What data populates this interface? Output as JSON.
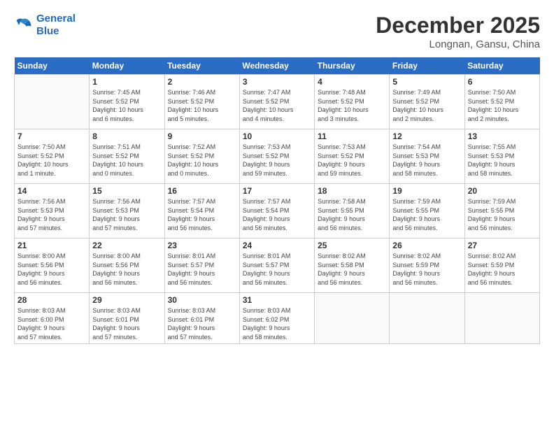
{
  "header": {
    "logo_line1": "General",
    "logo_line2": "Blue",
    "month": "December 2025",
    "location": "Longnan, Gansu, China"
  },
  "weekdays": [
    "Sunday",
    "Monday",
    "Tuesday",
    "Wednesday",
    "Thursday",
    "Friday",
    "Saturday"
  ],
  "weeks": [
    [
      {
        "day": "",
        "info": ""
      },
      {
        "day": "1",
        "info": "Sunrise: 7:45 AM\nSunset: 5:52 PM\nDaylight: 10 hours\nand 6 minutes."
      },
      {
        "day": "2",
        "info": "Sunrise: 7:46 AM\nSunset: 5:52 PM\nDaylight: 10 hours\nand 5 minutes."
      },
      {
        "day": "3",
        "info": "Sunrise: 7:47 AM\nSunset: 5:52 PM\nDaylight: 10 hours\nand 4 minutes."
      },
      {
        "day": "4",
        "info": "Sunrise: 7:48 AM\nSunset: 5:52 PM\nDaylight: 10 hours\nand 3 minutes."
      },
      {
        "day": "5",
        "info": "Sunrise: 7:49 AM\nSunset: 5:52 PM\nDaylight: 10 hours\nand 2 minutes."
      },
      {
        "day": "6",
        "info": "Sunrise: 7:50 AM\nSunset: 5:52 PM\nDaylight: 10 hours\nand 2 minutes."
      }
    ],
    [
      {
        "day": "7",
        "info": "Sunrise: 7:50 AM\nSunset: 5:52 PM\nDaylight: 10 hours\nand 1 minute."
      },
      {
        "day": "8",
        "info": "Sunrise: 7:51 AM\nSunset: 5:52 PM\nDaylight: 10 hours\nand 0 minutes."
      },
      {
        "day": "9",
        "info": "Sunrise: 7:52 AM\nSunset: 5:52 PM\nDaylight: 10 hours\nand 0 minutes."
      },
      {
        "day": "10",
        "info": "Sunrise: 7:53 AM\nSunset: 5:52 PM\nDaylight: 9 hours\nand 59 minutes."
      },
      {
        "day": "11",
        "info": "Sunrise: 7:53 AM\nSunset: 5:52 PM\nDaylight: 9 hours\nand 59 minutes."
      },
      {
        "day": "12",
        "info": "Sunrise: 7:54 AM\nSunset: 5:53 PM\nDaylight: 9 hours\nand 58 minutes."
      },
      {
        "day": "13",
        "info": "Sunrise: 7:55 AM\nSunset: 5:53 PM\nDaylight: 9 hours\nand 58 minutes."
      }
    ],
    [
      {
        "day": "14",
        "info": "Sunrise: 7:56 AM\nSunset: 5:53 PM\nDaylight: 9 hours\nand 57 minutes."
      },
      {
        "day": "15",
        "info": "Sunrise: 7:56 AM\nSunset: 5:53 PM\nDaylight: 9 hours\nand 57 minutes."
      },
      {
        "day": "16",
        "info": "Sunrise: 7:57 AM\nSunset: 5:54 PM\nDaylight: 9 hours\nand 56 minutes."
      },
      {
        "day": "17",
        "info": "Sunrise: 7:57 AM\nSunset: 5:54 PM\nDaylight: 9 hours\nand 56 minutes."
      },
      {
        "day": "18",
        "info": "Sunrise: 7:58 AM\nSunset: 5:55 PM\nDaylight: 9 hours\nand 56 minutes."
      },
      {
        "day": "19",
        "info": "Sunrise: 7:59 AM\nSunset: 5:55 PM\nDaylight: 9 hours\nand 56 minutes."
      },
      {
        "day": "20",
        "info": "Sunrise: 7:59 AM\nSunset: 5:55 PM\nDaylight: 9 hours\nand 56 minutes."
      }
    ],
    [
      {
        "day": "21",
        "info": "Sunrise: 8:00 AM\nSunset: 5:56 PM\nDaylight: 9 hours\nand 56 minutes."
      },
      {
        "day": "22",
        "info": "Sunrise: 8:00 AM\nSunset: 5:56 PM\nDaylight: 9 hours\nand 56 minutes."
      },
      {
        "day": "23",
        "info": "Sunrise: 8:01 AM\nSunset: 5:57 PM\nDaylight: 9 hours\nand 56 minutes."
      },
      {
        "day": "24",
        "info": "Sunrise: 8:01 AM\nSunset: 5:57 PM\nDaylight: 9 hours\nand 56 minutes."
      },
      {
        "day": "25",
        "info": "Sunrise: 8:02 AM\nSunset: 5:58 PM\nDaylight: 9 hours\nand 56 minutes."
      },
      {
        "day": "26",
        "info": "Sunrise: 8:02 AM\nSunset: 5:59 PM\nDaylight: 9 hours\nand 56 minutes."
      },
      {
        "day": "27",
        "info": "Sunrise: 8:02 AM\nSunset: 5:59 PM\nDaylight: 9 hours\nand 56 minutes."
      }
    ],
    [
      {
        "day": "28",
        "info": "Sunrise: 8:03 AM\nSunset: 6:00 PM\nDaylight: 9 hours\nand 57 minutes."
      },
      {
        "day": "29",
        "info": "Sunrise: 8:03 AM\nSunset: 6:01 PM\nDaylight: 9 hours\nand 57 minutes."
      },
      {
        "day": "30",
        "info": "Sunrise: 8:03 AM\nSunset: 6:01 PM\nDaylight: 9 hours\nand 57 minutes."
      },
      {
        "day": "31",
        "info": "Sunrise: 8:03 AM\nSunset: 6:02 PM\nDaylight: 9 hours\nand 58 minutes."
      },
      {
        "day": "",
        "info": ""
      },
      {
        "day": "",
        "info": ""
      },
      {
        "day": "",
        "info": ""
      }
    ]
  ]
}
